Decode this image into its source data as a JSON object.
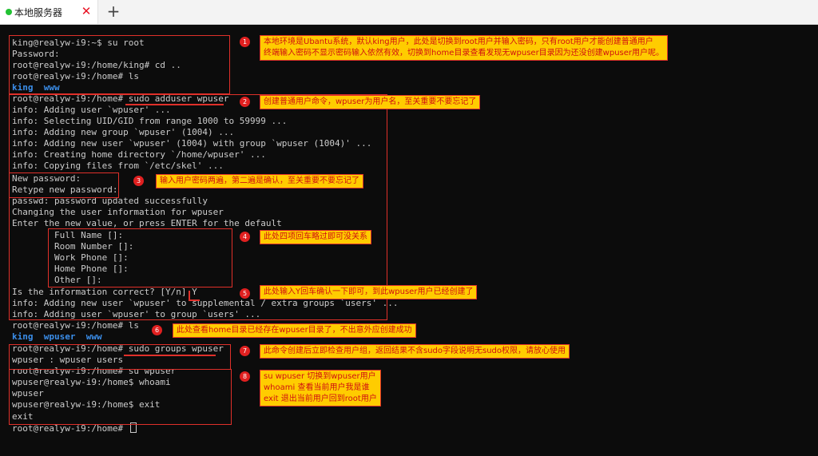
{
  "tab": {
    "title": "本地服务器",
    "close_glyph": "✕",
    "status_color": "#22c233"
  },
  "new_tab": {
    "glyph": "+"
  },
  "terminal": {
    "lines": [
      "king@realyw-i9:~$ su root",
      "Password:",
      "root@realyw-i9:/home/king# cd ..",
      "root@realyw-i9:/home# ls",
      "",
      "root@realyw-i9:/home# sudo adduser wpuser",
      "info: Adding user `wpuser' ...",
      "info: Selecting UID/GID from range 1000 to 59999 ...",
      "info: Adding new group `wpuser' (1004) ...",
      "info: Adding new user `wpuser' (1004) with group `wpuser (1004)' ...",
      "info: Creating home directory `/home/wpuser' ...",
      "info: Copying files from `/etc/skel' ...",
      "New password:",
      "Retype new password:",
      "passwd: password updated successfully",
      "Changing the user information for wpuser",
      "Enter the new value, or press ENTER for the default",
      "        Full Name []:",
      "        Room Number []:",
      "        Work Phone []:",
      "        Home Phone []:",
      "        Other []:",
      "Is the information correct? [Y/n] Y",
      "info: Adding new user `wpuser' to supplemental / extra groups `users' ...",
      "info: Adding user `wpuser' to group `users' ...",
      "root@realyw-i9:/home# ls",
      "",
      "root@realyw-i9:/home# sudo groups wpuser",
      "wpuser : wpuser users",
      "root@realyw-i9:/home# su wpuser",
      "wpuser@realyw-i9:/home$ whoami",
      "wpuser",
      "wpuser@realyw-i9:/home$ exit",
      "exit",
      "root@realyw-i9:/home# "
    ],
    "ls_first": {
      "a": "king",
      "b": "www"
    },
    "ls_second": {
      "a": "king",
      "b": "wpuser",
      "c": "www"
    }
  },
  "annotations": [
    {
      "num": "1",
      "lines": [
        "本地环境是Ubantu系统，默认king用户，此处是切换到root用户并输入密码，只有root用户才能创建普通用户",
        "终端输入密码不显示密码输入依然有效，切换到home目录查看发现无wpuser目录因为还没创建wpuser用户呢。"
      ]
    },
    {
      "num": "2",
      "lines": [
        "创建普通用户命令，wpuser为用户名，至关重要不要忘记了"
      ]
    },
    {
      "num": "3",
      "lines": [
        "输入用户密码两遍，第二遍是确认，至关重要不要忘记了"
      ]
    },
    {
      "num": "4",
      "lines": [
        "此处四项回车略过即可没关系"
      ]
    },
    {
      "num": "5",
      "lines": [
        "此处输入Y回车确认一下即可，到此wpuser用户已经创建了"
      ]
    },
    {
      "num": "6",
      "lines": [
        "此处查看home目录已经存在wpuser目录了，不出意外应创建成功"
      ]
    },
    {
      "num": "7",
      "lines": [
        "此命令创建后立即检查用户组，返回结果不含sudo字段说明无sudo权限，请放心使用"
      ]
    },
    {
      "num": "8",
      "lines": [
        "su wpuser 切换到wpuser用户",
        "whoami 查看当前用户我是谁",
        "exit 退出当前用户回到root用户"
      ]
    }
  ],
  "colors": {
    "background": "#0c0c0c",
    "text": "#cccccc",
    "directory": "#3b8eea",
    "annotation_red": "#e0302a",
    "note_bg": "#ffcc00",
    "note_text": "#d01010"
  }
}
